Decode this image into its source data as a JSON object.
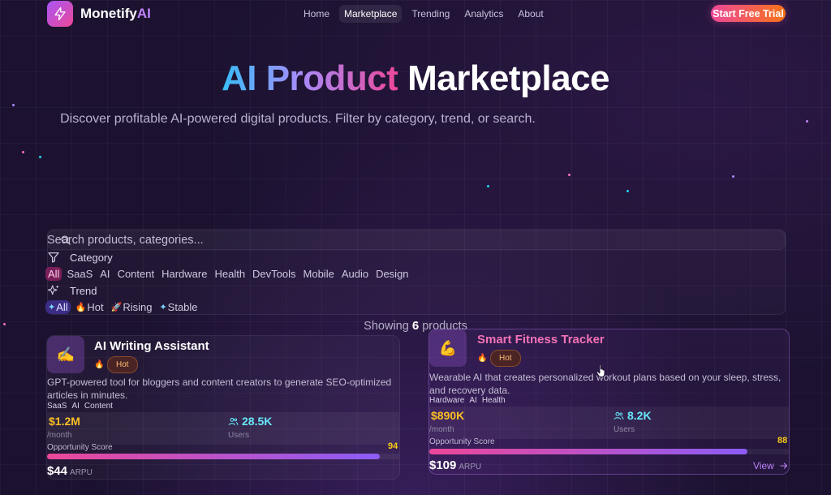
{
  "nav": {
    "brand_prefix": "Monetify",
    "brand_suffix": "AI",
    "links": [
      "Home",
      "Marketplace",
      "Trending",
      "Analytics",
      "About"
    ],
    "active_link": "Marketplace",
    "cta_label": "Start Free Trial"
  },
  "hero": {
    "title_gradient": "AI Product",
    "title_plain": "Marketplace",
    "subtitle": "Discover profitable AI-powered digital products. Filter by category, trend, or search."
  },
  "filters": {
    "search_placeholder": "Search products, categories...",
    "category_label": "Category",
    "categories": [
      "All",
      "SaaS",
      "AI",
      "Content",
      "Hardware",
      "Health",
      "DevTools",
      "Mobile",
      "Audio",
      "Design"
    ],
    "active_category": "All",
    "trend_label": "Trend",
    "trends": [
      {
        "label": "All",
        "icon": "sparkle-icon"
      },
      {
        "label": "Hot",
        "icon": "flame-icon"
      },
      {
        "label": "Rising",
        "icon": "rocket-icon"
      },
      {
        "label": "Stable",
        "icon": "sparkle-icon"
      }
    ],
    "active_trend": "All"
  },
  "results": {
    "prefix": "Showing",
    "count": "6",
    "suffix": "products"
  },
  "products": [
    {
      "emoji": "✍️",
      "title": "AI Writing Assistant",
      "trend_badge": "Hot",
      "description": "GPT-powered tool for bloggers and content creators to generate SEO-optimized articles in minutes.",
      "tags": [
        "SaaS",
        "AI",
        "Content"
      ],
      "revenue": "$1.2M",
      "revenue_unit": "/month",
      "users": "28.5K",
      "users_label": "Users",
      "opportunity_label": "Opportunity Score",
      "opportunity_score": 94,
      "arpu_value": "$44",
      "arpu_label": "ARPU"
    },
    {
      "emoji": "💪",
      "title": "Smart Fitness Tracker",
      "trend_badge": "Hot",
      "description": "Wearable AI that creates personalized workout plans based on your sleep, stress, and recovery data.",
      "tags": [
        "Hardware",
        "AI",
        "Health"
      ],
      "revenue": "$890K",
      "revenue_unit": "/month",
      "users": "8.2K",
      "users_label": "Users",
      "opportunity_label": "Opportunity Score",
      "opportunity_score": 88,
      "arpu_value": "$109",
      "arpu_label": "ARPU",
      "view_label": "View"
    }
  ],
  "colors": {
    "background": "#1c1230",
    "accent_pink": "#ec4899",
    "accent_purple": "#8b5cf6",
    "revenue_gold": "#fbbf24",
    "users_cyan": "#67e8f9"
  }
}
